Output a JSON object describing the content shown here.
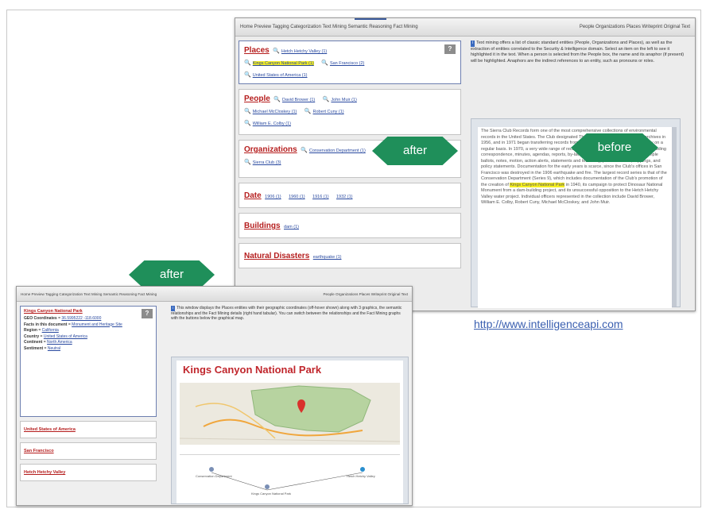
{
  "labels": {
    "after_top": "after",
    "before": "before",
    "after_bottom": "after"
  },
  "url": "http://www.intelligenceapi.com",
  "shot_top": {
    "nav_left": "Home  Preview  Tagging  Categorization  Text Mining  Semantic Reasoning  Fact Mining",
    "nav_right": "People  Organizations  Places  Writeprint  Original Text",
    "places": {
      "title": "Places",
      "items": [
        "Hetch Hetchy Valley (1)",
        "Kings Canyon National Park (1)",
        "San Francisco (2)",
        "United States of America (1)"
      ]
    },
    "people": {
      "title": "People",
      "items": [
        "David Brower (1)",
        "John Muir (1)",
        "Michael McCloskey (1)",
        "Robert Cuny (1)",
        "William E. Colby (1)"
      ]
    },
    "organizations": {
      "title": "Organizations",
      "items": [
        "Conservation Department (1)",
        "Sierra Club (3)"
      ]
    },
    "date": {
      "title": "Date",
      "items": [
        "1906 (1)",
        "1960 (1)",
        "1916 (1)",
        "1932 (1)"
      ]
    },
    "buildings": {
      "title": "Buildings",
      "items": [
        "dam (1)"
      ]
    },
    "disasters": {
      "title": "Natural Disasters",
      "items": [
        "earthquake (1)"
      ]
    },
    "help_text": "Text mining offers a list of classic standard entities (People, Organizations and Places), as well as the extraction of entities correlated to the Security & Intelligence domain. Select an item on the left to see it highlighted it in the text. When a person is selected from the People box, the name and its anaphor (if present) will be highlighted. Anaphors are the indirect references to an entity, such as pronouns or roles.",
    "doc_text_before": "The Sierra Club Records form one of the most comprehensive collections of environmental records in the United States. The Club designated The Bancroft Library as its official archives in 1956, and in 1971 began transferring records from the San Francisco office to the Library on a regular basis. In 1970, a very wide range of record types are included in the collection, including correspondence, minutes, agendas, reports, by-laws, financial records, scrapbooks, sample ballots, notes, motion, action alerts, statements and testimony, press releases, clippings, and policy statements. Documentation for the early years is scarce, since the Club's offices in San Francisco was destroyed in the 1906 earthquake and fire. The largest record series is that of the Conservation Department (Series 9), which includes documentation of the Club's promotion of the creation of",
    "doc_highlight": "Kings Canyon National Park",
    "doc_text_after": "in 1940, its campaign to protect Dinosaur National Monument from a dam-building project, and its unsuccessful opposition to the Hetch Hetchy Valley water project. Individual officers represented in the collection include David Brower, William E. Colby, Robert Cuny, Michael McCloskey, and John Muir."
  },
  "shot_bottom": {
    "nav_left": "Home  Preview  Tagging  Categorization  Text Mining  Semantic Reasoning  Fact Mining",
    "nav_right": "People  Organizations  Places  Writeprint  Original Text",
    "selected_place": "Kings Canyon National Park",
    "details": [
      {
        "k": "GEO Coordinates",
        "v": "36.5995222 -118.6000"
      },
      {
        "k": "Facts in this document",
        "v": "Monument and Heritage Site"
      },
      {
        "k": "Region",
        "v": "California"
      },
      {
        "k": "Country",
        "v": "United States of America"
      },
      {
        "k": "Continent",
        "v": "North America"
      },
      {
        "k": "Sentiment",
        "v": "Neutral"
      }
    ],
    "other_places": [
      "United States of America",
      "San Francisco",
      "Hetch Hetchy Valley"
    ],
    "help_text": "This window displays the Places entities with their geographic coordinates (off-hover shown) along with 3 graphics, the semantic relationships and the Fact Mining details (right hand tabular). You can switch between the relationships and the Fact Mining graphs with the buttons below the graphical map.",
    "map_title": "Kings Canyon National Park",
    "graph_nodes": [
      "Conservation Department",
      "Hetch Hetchy Valley",
      "Kings Canyon National Park"
    ]
  },
  "colors": {
    "label_green": "#1f8f5a",
    "entity_red": "#b51d1d",
    "highlight": "#f5ef22",
    "link_blue": "#2a4aa0"
  }
}
